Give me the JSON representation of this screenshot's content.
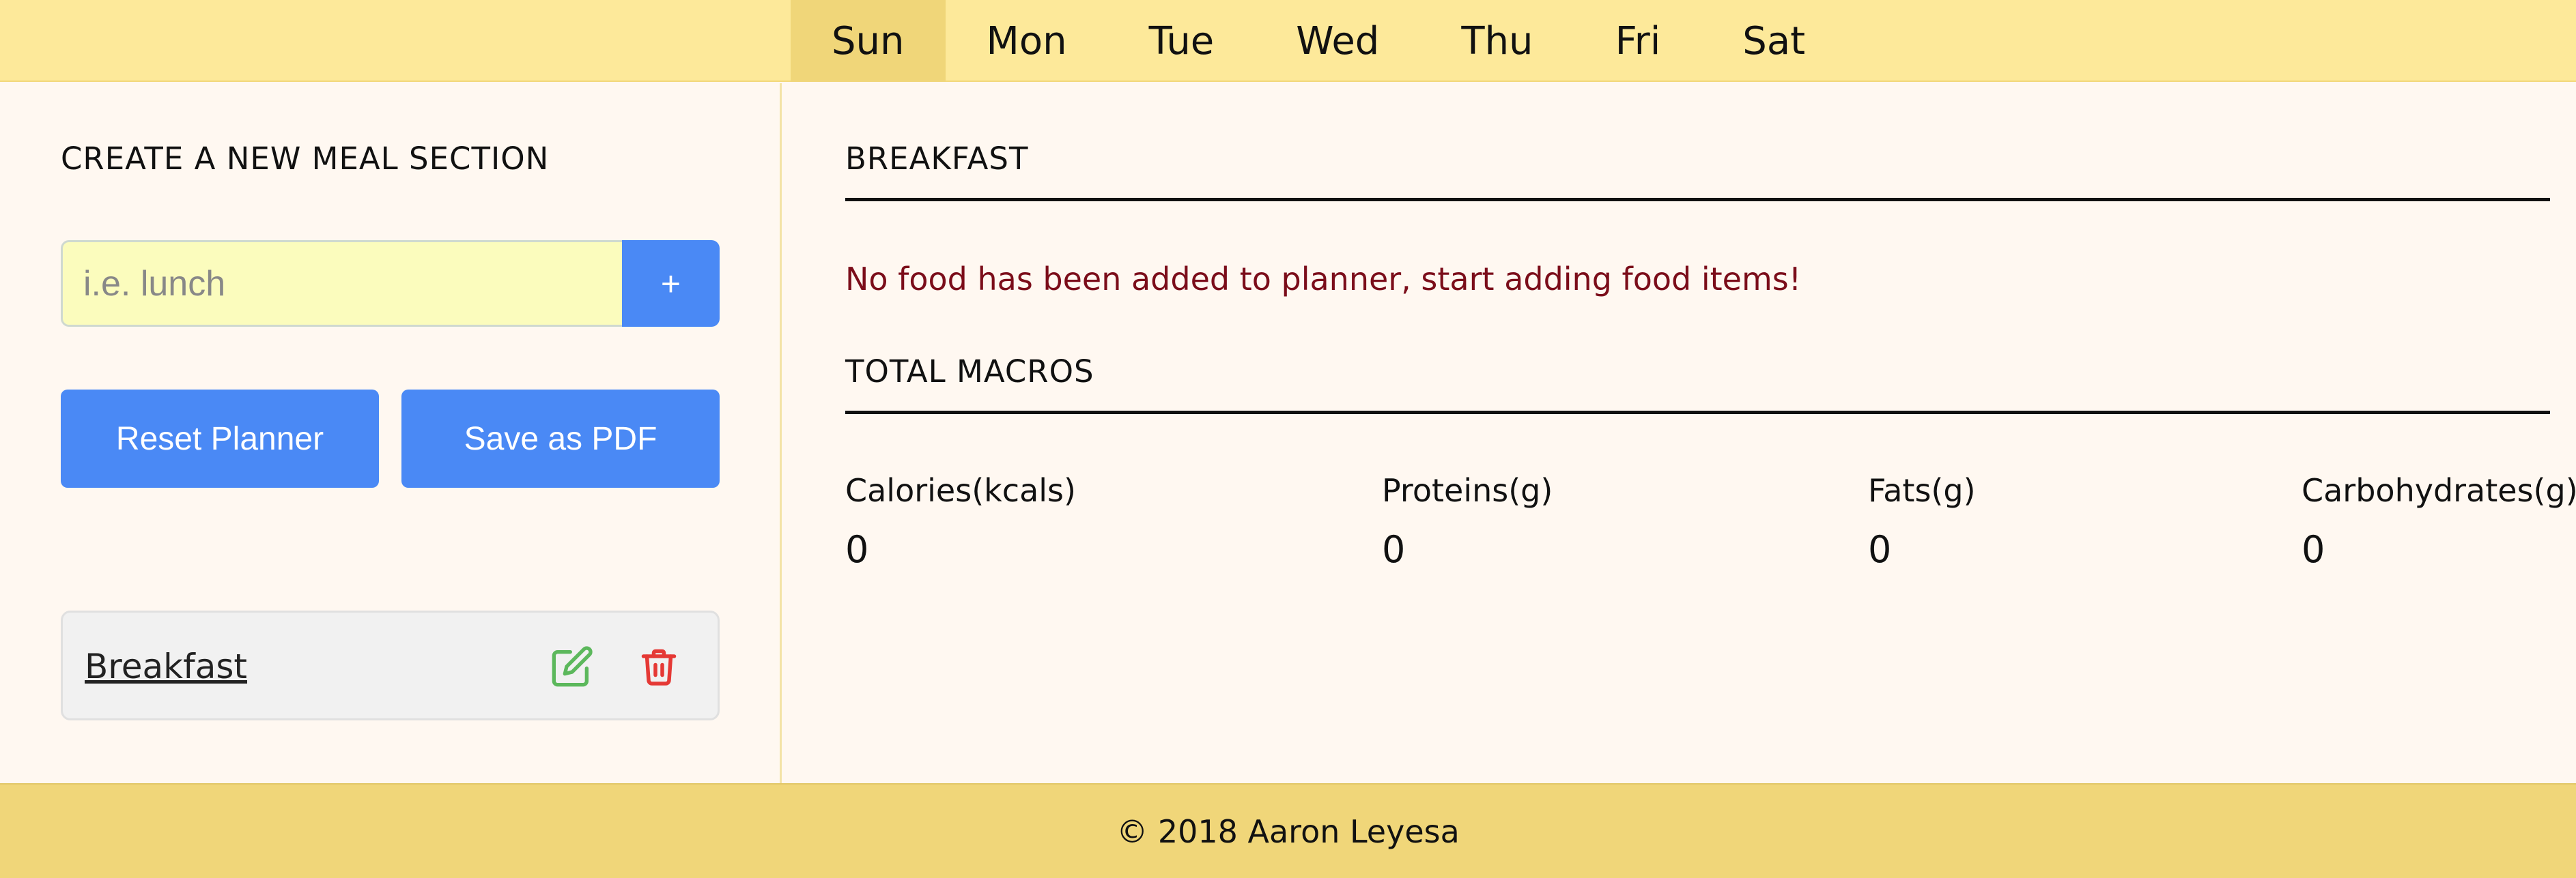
{
  "days": [
    {
      "label": "Sun",
      "active": true
    },
    {
      "label": "Mon",
      "active": false
    },
    {
      "label": "Tue",
      "active": false
    },
    {
      "label": "Wed",
      "active": false
    },
    {
      "label": "Thu",
      "active": false
    },
    {
      "label": "Fri",
      "active": false
    },
    {
      "label": "Sat",
      "active": false
    }
  ],
  "sidebar": {
    "title": "CREATE A NEW MEAL SECTION",
    "input_placeholder": "i.e. lunch",
    "input_value": "",
    "add_label": "+",
    "reset_label": "Reset Planner",
    "pdf_label": "Save as PDF",
    "meals": [
      {
        "name": "Breakfast",
        "edit_icon": "edit-icon",
        "delete_icon": "trash-icon"
      }
    ]
  },
  "main": {
    "section_title": "BREAKFAST",
    "empty_message": "No food has been added to planner, start adding food items!",
    "totals_title": "TOTAL MACROS",
    "macros": [
      {
        "label": "Calories(kcals)",
        "value": "0"
      },
      {
        "label": "Proteins(g)",
        "value": "0"
      },
      {
        "label": "Fats(g)",
        "value": "0"
      },
      {
        "label": "Carbohydrates(g)",
        "value": "0"
      }
    ]
  },
  "footer": {
    "text": "© 2018 Aaron Leyesa"
  },
  "colors": {
    "header_bg": "#fde99a",
    "active_day_bg": "#f0d679",
    "button_blue": "#4a89f5",
    "input_bg": "#fbfcbd",
    "edit_green": "#5cb85c",
    "delete_red": "#e53935",
    "message_red": "#7b0d1a"
  }
}
